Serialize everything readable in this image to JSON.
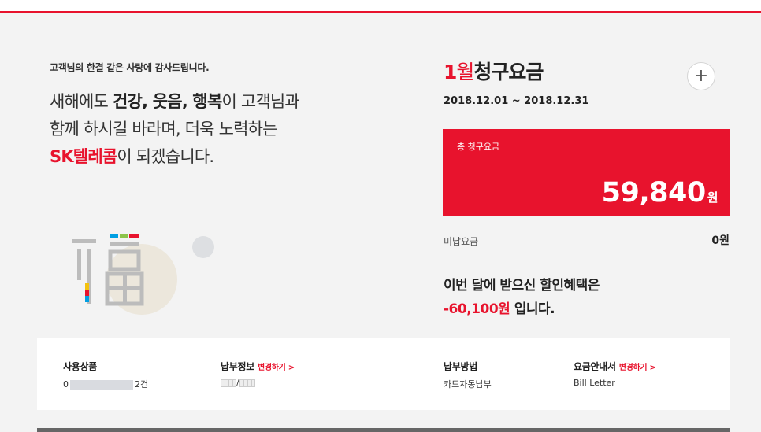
{
  "greeting": {
    "small": "고객님의 한결 같은 사랑에 감사드립니다.",
    "line1_pre": "새해에도 ",
    "line1_bold": "건강, 웃음, 행복",
    "line1_post": "이 고객님과",
    "line2": "함께 하시길 바라며, 더욱 노력하는",
    "line3_brand": "SK텔레콤",
    "line3_post": "이 되겠습니다."
  },
  "bill": {
    "month": "1",
    "month_unit": "월",
    "title": "청구요금",
    "period": "2018.12.01 ~ 2018.12.31",
    "expand_symbol": "+",
    "total_label": "총 청구요금",
    "total_amount": "59,840",
    "total_unit": "원",
    "unpaid_label": "미납요금",
    "unpaid_value": "0원",
    "discount_line1": "이번 달에 받으신 할인혜택은",
    "discount_amount": "-60,100원",
    "discount_suffix": " 입니다."
  },
  "info": {
    "product_head": "사용상품",
    "product_value_prefix": "0",
    "product_value_suffix": "2건",
    "payinfo_head": "납부정보",
    "payinfo_change": "변경하기 >",
    "payinfo_sep": "/",
    "paymethod_head": "납부방법",
    "paymethod_value": "카드자동납부",
    "statement_head": "요금안내서",
    "statement_change": "변경하기 >",
    "statement_value": "Bill Letter"
  },
  "colors": {
    "accent": "#e8132d",
    "background": "#f3f3f3"
  }
}
